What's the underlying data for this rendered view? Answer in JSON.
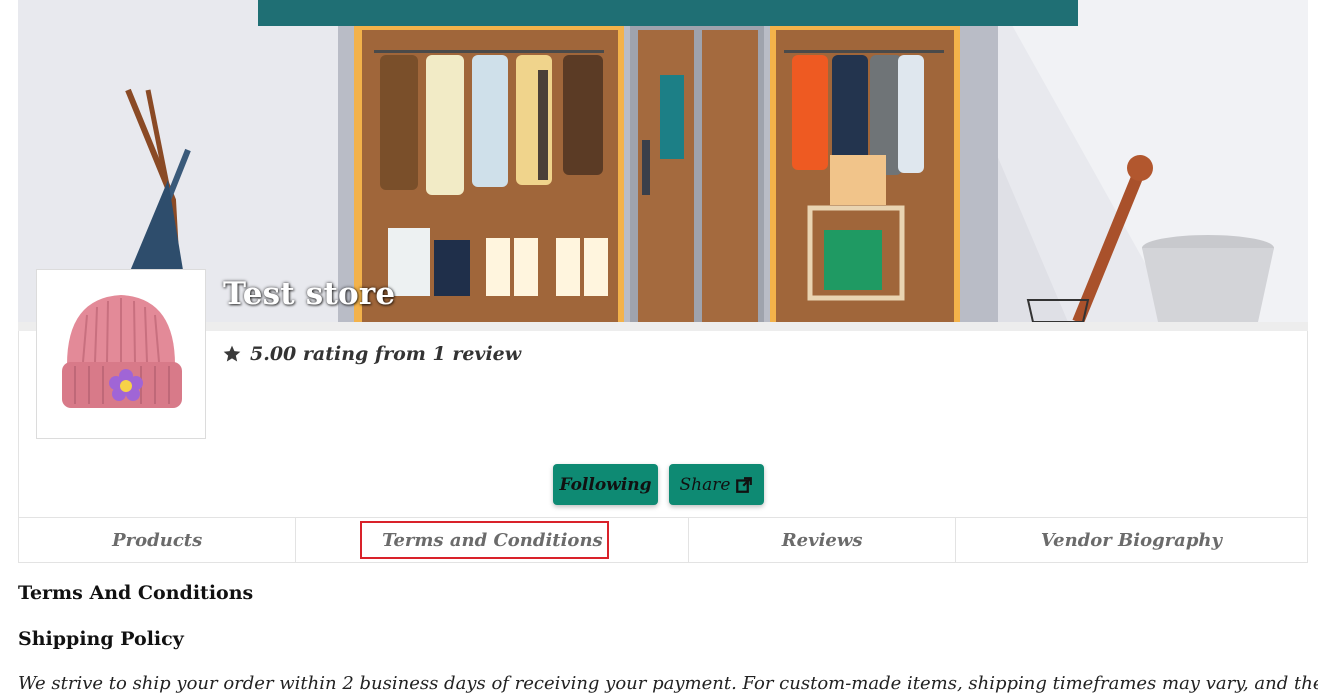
{
  "store": {
    "name": "Test store",
    "rating_text": "5.00 rating from 1 review"
  },
  "actions": {
    "follow_label": "Following",
    "share_label": "Share"
  },
  "tabs": [
    {
      "label": "Products"
    },
    {
      "label": "Terms and Conditions",
      "active": true
    },
    {
      "label": "Reviews"
    },
    {
      "label": "Vendor Biography"
    }
  ],
  "content": {
    "heading": "Terms And Conditions",
    "subheading": "Shipping Policy",
    "paragraph": "We strive to ship your order within 2 business days of receiving your payment. For custom-made items, shipping timeframes may vary, and the"
  },
  "icons": {
    "rating": "star-icon",
    "share": "external-link-icon"
  },
  "colors": {
    "button": "#0e8a73",
    "active_tab_outline": "#d9222a",
    "banner_teal": "#1f6f74"
  }
}
